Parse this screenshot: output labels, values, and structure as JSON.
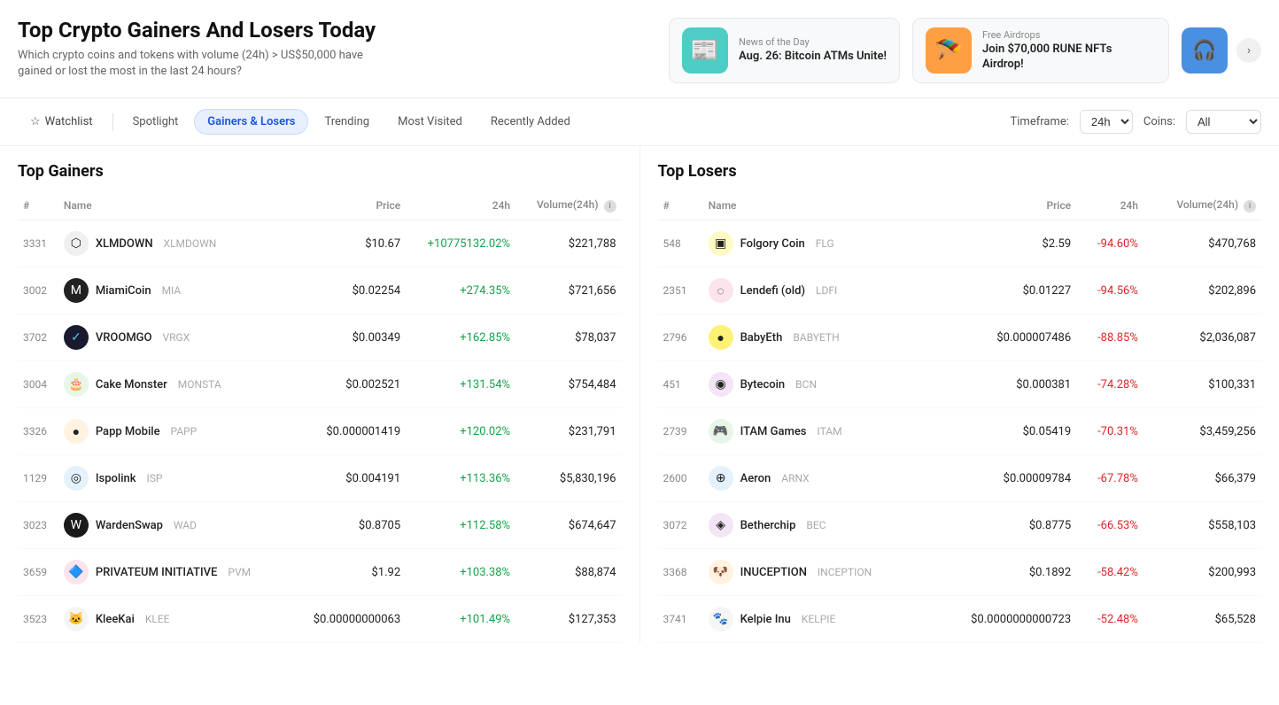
{
  "header": {
    "title": "Top Crypto Gainers And Losers Today",
    "subtitle": "Which crypto coins and tokens with volume (24h) > US$50,000 have gained or lost the most in the last 24 hours?",
    "news1": {
      "label": "News of the Day",
      "title": "Aug. 26: Bitcoin ATMs Unite!",
      "icon": "📰"
    },
    "news2": {
      "label": "Free Airdrops",
      "title": "Join $70,000 RUNE NFTs Airdrop!",
      "icon": "🪂"
    },
    "nav_icon": "🎧"
  },
  "tabs": {
    "watchlist": "Watchlist",
    "spotlight": "Spotlight",
    "gainers_losers": "Gainers & Losers",
    "trending": "Trending",
    "most_visited": "Most Visited",
    "recently_added": "Recently Added"
  },
  "controls": {
    "timeframe_label": "Timeframe:",
    "timeframe_value": "24h",
    "coins_label": "Coins:",
    "coins_value": "All"
  },
  "gainers": {
    "section_title": "Top Gainers",
    "columns": [
      "#",
      "Name",
      "Price",
      "24h",
      "Volume(24h)"
    ],
    "rows": [
      {
        "rank": "3331",
        "name": "XLMDOWN",
        "symbol": "XLMDOWN",
        "price": "$10.67",
        "change": "+10775132.02%",
        "volume": "$221,788",
        "icon": "⬡",
        "icon_class": "c-xlm"
      },
      {
        "rank": "3002",
        "name": "MiamiCoin",
        "symbol": "MIA",
        "price": "$0.02254",
        "change": "+274.35%",
        "volume": "$721,656",
        "icon": "M",
        "icon_class": "c-mia"
      },
      {
        "rank": "3702",
        "name": "VROOMGO",
        "symbol": "VRGX",
        "price": "$0.00349",
        "change": "+162.85%",
        "volume": "$78,037",
        "icon": "✓",
        "icon_class": "c-vrg"
      },
      {
        "rank": "3004",
        "name": "Cake Monster",
        "symbol": "MONSTA",
        "price": "$0.002521",
        "change": "+131.54%",
        "volume": "$754,484",
        "icon": "🎂",
        "icon_class": "c-mnst"
      },
      {
        "rank": "3326",
        "name": "Papp Mobile",
        "symbol": "PAPP",
        "price": "$0.000001419",
        "change": "+120.02%",
        "volume": "$231,791",
        "icon": "●",
        "icon_class": "c-papp"
      },
      {
        "rank": "1129",
        "name": "Ispolink",
        "symbol": "ISP",
        "price": "$0.004191",
        "change": "+113.36%",
        "volume": "$5,830,196",
        "icon": "◎",
        "icon_class": "c-isp"
      },
      {
        "rank": "3023",
        "name": "WardenSwap",
        "symbol": "WAD",
        "price": "$0.8705",
        "change": "+112.58%",
        "volume": "$674,647",
        "icon": "W",
        "icon_class": "c-wad"
      },
      {
        "rank": "3659",
        "name": "PRIVATEUM INITIATIVE",
        "symbol": "PVM",
        "price": "$1.92",
        "change": "+103.38%",
        "volume": "$88,874",
        "icon": "🔷",
        "icon_class": "c-pvm"
      },
      {
        "rank": "3523",
        "name": "KleeKai",
        "symbol": "KLEE",
        "price": "$0.00000000063",
        "change": "+101.49%",
        "volume": "$127,353",
        "icon": "🐱",
        "icon_class": "c-klee"
      }
    ]
  },
  "losers": {
    "section_title": "Top Losers",
    "columns": [
      "#",
      "Name",
      "Price",
      "24h",
      "Volume(24h)"
    ],
    "rows": [
      {
        "rank": "548",
        "name": "Folgory Coin",
        "symbol": "FLG",
        "price": "$2.59",
        "change": "-94.60%",
        "volume": "$470,768",
        "icon": "▣",
        "icon_class": "c-flg"
      },
      {
        "rank": "2351",
        "name": "Lendefi (old)",
        "symbol": "LDFI",
        "price": "$0.01227",
        "change": "-94.56%",
        "volume": "$202,896",
        "icon": "◌",
        "icon_class": "c-ldfi"
      },
      {
        "rank": "2796",
        "name": "BabyEth",
        "symbol": "BABYETH",
        "price": "$0.000007486",
        "change": "-88.85%",
        "volume": "$2,036,087",
        "icon": "●",
        "icon_class": "c-baby"
      },
      {
        "rank": "451",
        "name": "Bytecoin",
        "symbol": "BCN",
        "price": "$0.000381",
        "change": "-74.28%",
        "volume": "$100,331",
        "icon": "◉",
        "icon_class": "c-bcn"
      },
      {
        "rank": "2739",
        "name": "ITAM Games",
        "symbol": "ITAM",
        "price": "$0.05419",
        "change": "-70.31%",
        "volume": "$3,459,256",
        "icon": "🎮",
        "icon_class": "c-itam"
      },
      {
        "rank": "2600",
        "name": "Aeron",
        "symbol": "ARNX",
        "price": "$0.00009784",
        "change": "-67.78%",
        "volume": "$66,379",
        "icon": "⊕",
        "icon_class": "c-arnx"
      },
      {
        "rank": "3072",
        "name": "Betherchip",
        "symbol": "BEC",
        "price": "$0.8775",
        "change": "-66.53%",
        "volume": "$558,103",
        "icon": "◈",
        "icon_class": "c-bec"
      },
      {
        "rank": "3368",
        "name": "INUCEPTION",
        "symbol": "INCEPTION",
        "price": "$0.1892",
        "change": "-58.42%",
        "volume": "$200,993",
        "icon": "🐶",
        "icon_class": "c-inc"
      },
      {
        "rank": "3741",
        "name": "Kelpie Inu",
        "symbol": "KELPIE",
        "price": "$0.0000000000723",
        "change": "-52.48%",
        "volume": "$65,528",
        "icon": "🐾",
        "icon_class": "c-kelp"
      }
    ]
  }
}
